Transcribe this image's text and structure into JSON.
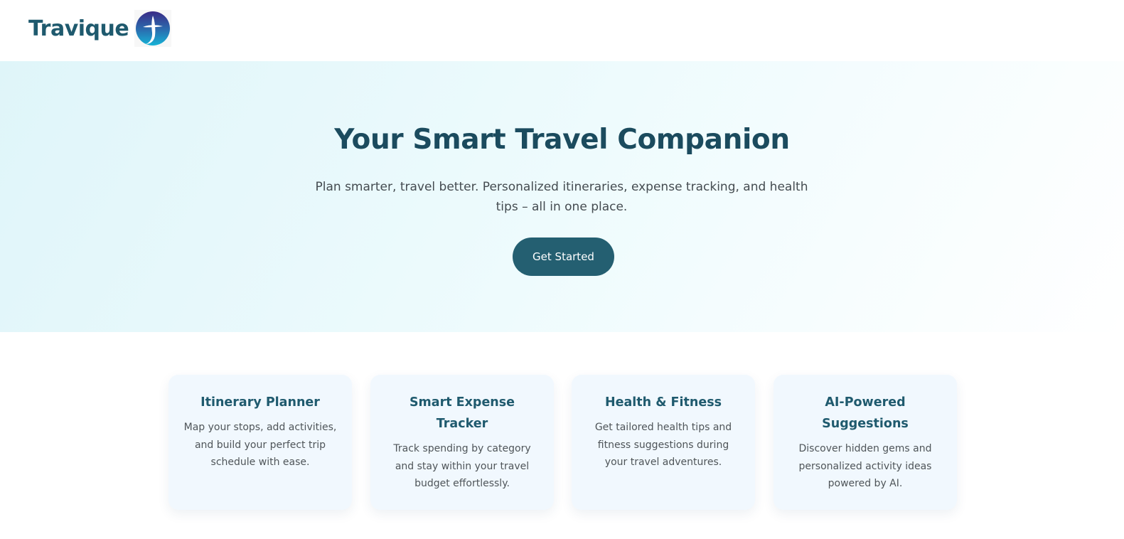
{
  "header": {
    "brand_name": "Travique",
    "logo_icon": "travique-logo-icon",
    "brand_color": "#1f5a6e"
  },
  "hero": {
    "title": "Your Smart Travel Companion",
    "subtitle": "Plan smarter, travel better. Personalized itineraries, expense tracking, and health tips – all in one place.",
    "cta_label": "Get Started",
    "cta_color": "#245f71"
  },
  "features": [
    {
      "title": "Itinerary Planner",
      "text": "Map your stops, add activities, and build your perfect trip schedule with ease."
    },
    {
      "title": "Smart Expense Tracker",
      "text": "Track spending by category and stay within your travel budget effortlessly."
    },
    {
      "title": "Health & Fitness",
      "text": "Get tailored health tips and fitness suggestions during your travel adventures."
    },
    {
      "title": "AI-Powered Suggestions",
      "text": "Discover hidden gems and personalized activity ideas powered by AI."
    }
  ]
}
